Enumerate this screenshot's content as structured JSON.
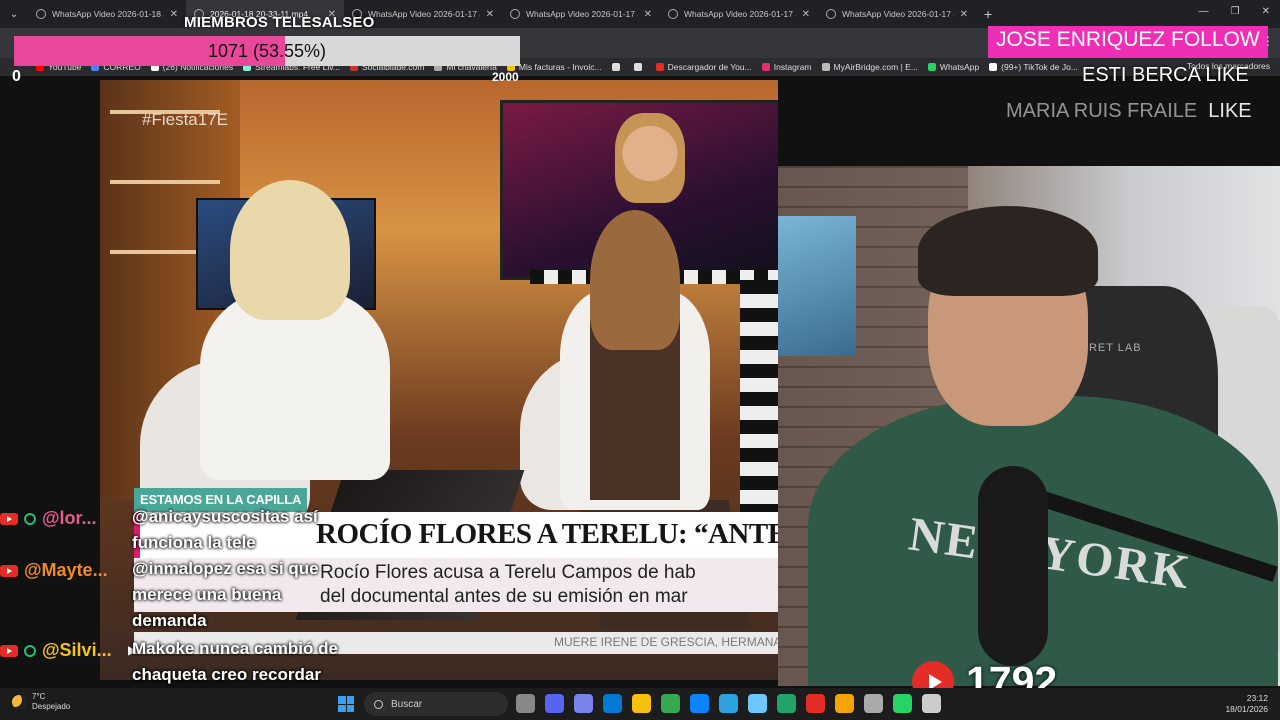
{
  "browser": {
    "tabs": [
      {
        "label": "WhatsApp Video 2026-01-18 a",
        "active": false
      },
      {
        "label": "2026-01-18 20-33-11.mp4",
        "active": true
      },
      {
        "label": "WhatsApp Video 2026-01-17 a",
        "active": false
      },
      {
        "label": "WhatsApp Video 2026-01-17 a",
        "active": false
      },
      {
        "label": "WhatsApp Video 2026-01-17 a",
        "active": false
      },
      {
        "label": "WhatsApp Video 2026-01-17 a",
        "active": false
      }
    ],
    "new_tab": "+",
    "bookmarks": [
      {
        "label": "YouTube",
        "color": "#ff0000"
      },
      {
        "label": "CORREO",
        "color": "#4285f4"
      },
      {
        "label": "(26) Notificaciones",
        "color": "#ffffff"
      },
      {
        "label": "Streamlabs: Free Liv...",
        "color": "#80f5d2"
      },
      {
        "label": "Socialblade.com",
        "color": "#c0392b"
      },
      {
        "label": "Mi chavalería",
        "color": "#aaaaaa"
      },
      {
        "label": "Mis facturas - Invoic...",
        "color": "#f4c20d"
      },
      {
        "label": "",
        "color": "#dddddd"
      },
      {
        "label": "",
        "color": "#dddddd"
      },
      {
        "label": "Descargador de You...",
        "color": "#e52d27"
      },
      {
        "label": "Instagram",
        "color": "#e1306c"
      },
      {
        "label": "MyAirBridge.com | E...",
        "color": "#bbbbbb"
      },
      {
        "label": "WhatsApp",
        "color": "#25d366"
      },
      {
        "label": "(99+) TikTok de Jo...",
        "color": "#ffffff"
      }
    ],
    "all_bookmarks": "Todos los marcadores"
  },
  "overlay": {
    "members_title": "MIEMBROS TELESALSEO",
    "goal_text": "1071 (53.55%)",
    "goal_fraction": 0.5355,
    "goal_min": "0",
    "goal_max": "2000",
    "follow_alert": "JOSE ENRIQUEZ  FOLLOW",
    "like_alert_1": "ESTI BERCA  LIKE",
    "like_alert_2_name": "MARIA RUIS FRAILE",
    "like_alert_2_action": "LIKE"
  },
  "tv": {
    "hashtag": "#Fiesta17E",
    "tag": "ESTAMOS EN LA CAPILLA",
    "headline": "ROCÍO FLORES A TERELU: “ANTES DE LA EMISIÓ",
    "sub_line_1": "Rocío Flores acusa a Terelu Campos de hab",
    "sub_line_2": "del documental antes de su emisión en mar",
    "ticker": "MUERE IRENE DE GRESCIA, HERMANA D"
  },
  "webcam": {
    "shirt_text": "NEW YORK",
    "chair_text": "CRET LAB"
  },
  "chat": {
    "messages": [
      {
        "user": "@lor...",
        "user_color": "#e55b8e",
        "text": "@anicaysuscositas así funciona la tele"
      },
      {
        "user": "@Mayte...",
        "user_color": "#f08a2a",
        "text": "@inmalopez esa si que merece una buena demanda"
      },
      {
        "user": "@Silvi...",
        "user_color": "#f2c21d",
        "text": "Makoke nunca cambió de chaqueta creo recordar"
      }
    ]
  },
  "youtube": {
    "viewer_count": "1792"
  },
  "taskbar": {
    "temperature": "7°C",
    "weather": "Despejado",
    "search_placeholder": "Buscar",
    "time": "23:12",
    "date": "18/01/2026",
    "icon_colors": [
      "#888888",
      "#5865f2",
      "#7b83eb",
      "#0078d4",
      "#f4c20d",
      "#34a853",
      "#0a84ff",
      "#2aa3e0",
      "#6ec6ff",
      "#22a36b",
      "#e52d27",
      "#f4a300",
      "#aaaaaa",
      "#25d366",
      "#cccccc"
    ]
  }
}
